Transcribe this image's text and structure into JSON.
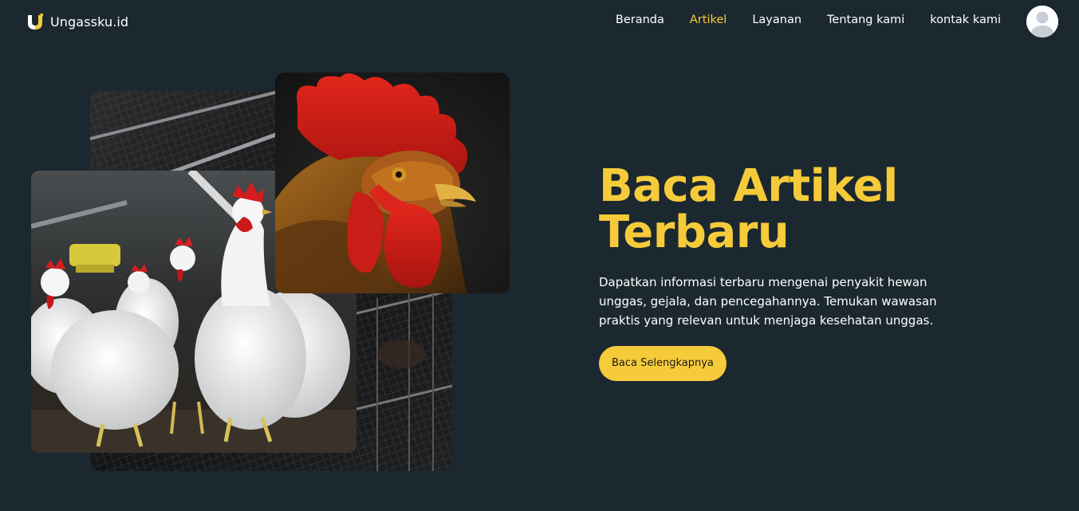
{
  "brand": {
    "name": "Ungassku.id",
    "logo_icon": "brand-u-icon",
    "accent": "#f5cb3a"
  },
  "nav": {
    "items": [
      {
        "label": "Beranda",
        "active": false
      },
      {
        "label": "Artikel",
        "active": true
      },
      {
        "label": "Layanan",
        "active": false
      },
      {
        "label": "Tentang kami",
        "active": false
      },
      {
        "label": "kontak kami",
        "active": false
      }
    ],
    "avatar_icon": "user-avatar-icon"
  },
  "hero": {
    "title_line1": "Baca Artikel",
    "title_line2": "Terbaru",
    "description": "Dapatkan informasi terbaru mengenai penyakit hewan unggas, gejala, dan pencegahannya. Temukan wawasan praktis yang relevan untuk menjaga kesehatan unggas.",
    "cta_label": "Baca Selengkapnya"
  },
  "colors": {
    "background": "#1c2830",
    "accent": "#f5cb3a",
    "text": "#ffffff"
  }
}
